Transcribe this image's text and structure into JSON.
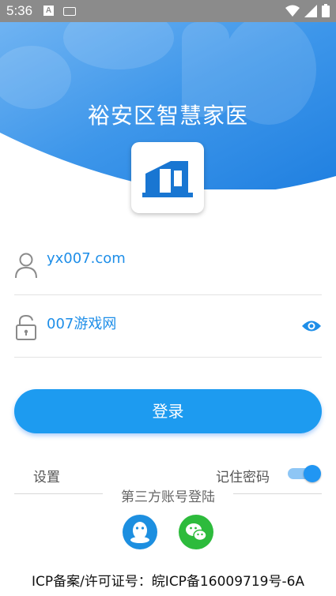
{
  "status_bar": {
    "time": "5:36"
  },
  "app": {
    "title": "裕安区智慧家医"
  },
  "form": {
    "username_value": "yx007.com",
    "password_value": "007游戏网",
    "login_label": "登录"
  },
  "options": {
    "settings_label": "设置",
    "remember_label": "记住密码",
    "remember_on": true
  },
  "third_party": {
    "label": "第三方账号登陆"
  },
  "footer": {
    "icp": "ICP备案/许可证号：皖ICP备16009719号-6A"
  },
  "colors": {
    "accent": "#1d9bf0",
    "hero": "#2f8de6",
    "qq": "#1d8fe0",
    "wechat": "#2dbb3c"
  },
  "icons": [
    "user-icon",
    "lock-icon",
    "eye-icon",
    "qq-icon",
    "wechat-icon",
    "wifi-icon",
    "signal-icon",
    "battery-icon"
  ]
}
